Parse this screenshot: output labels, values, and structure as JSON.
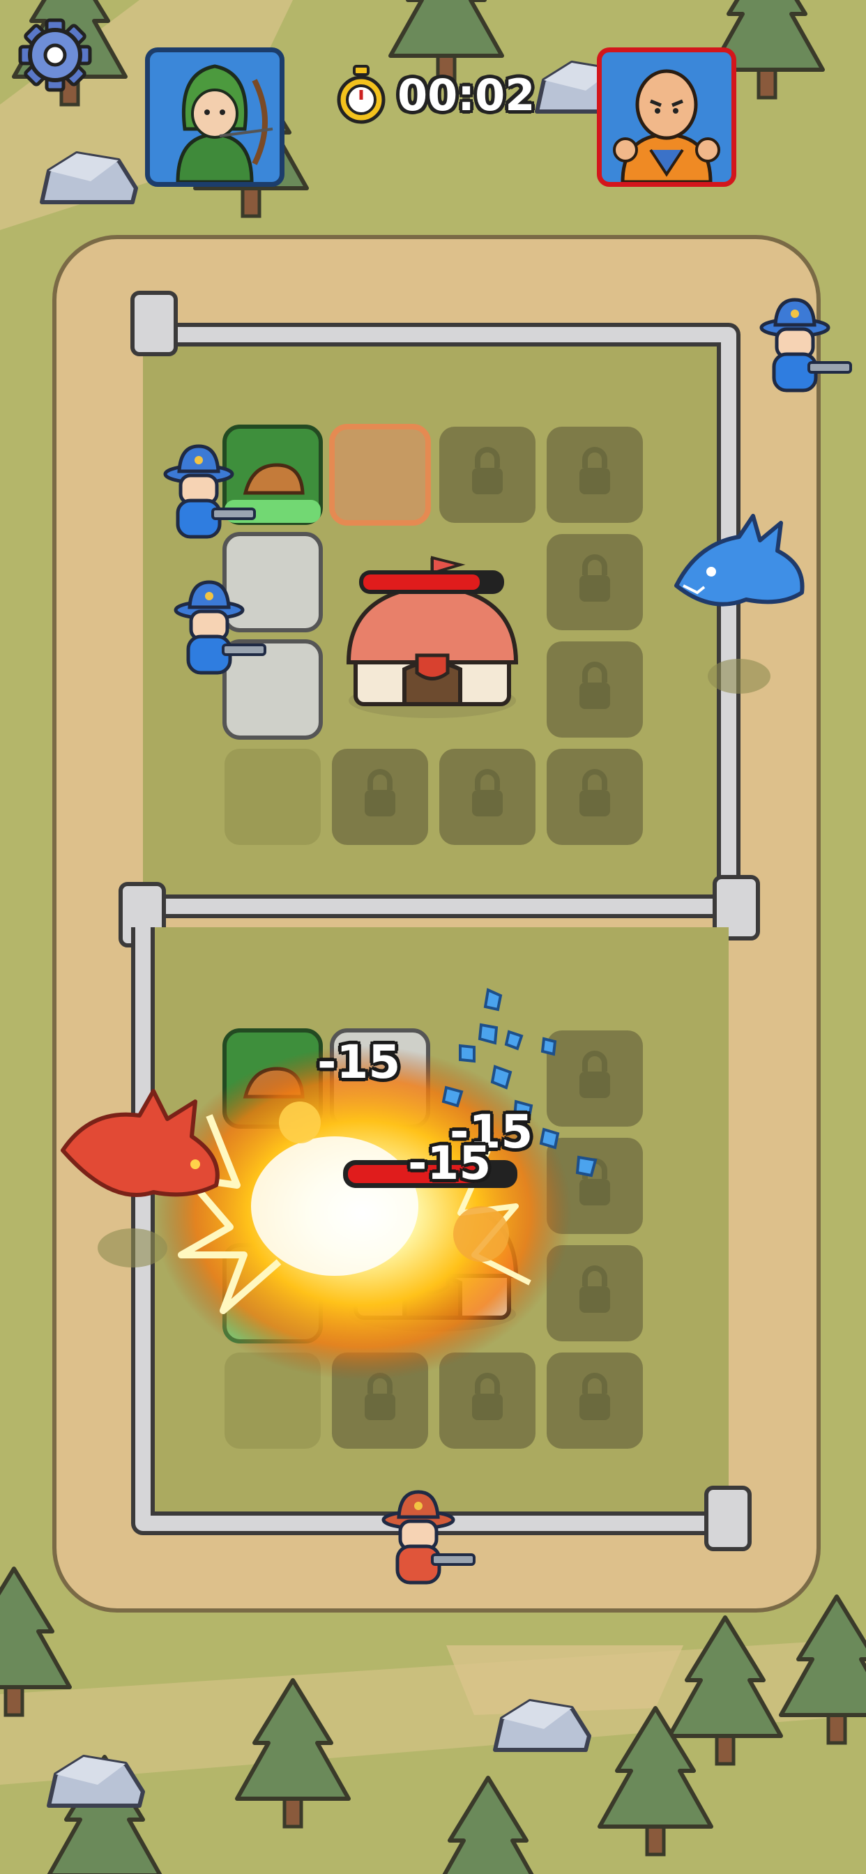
{
  "hud": {
    "settings_icon": "gear-icon",
    "player_portrait": "archer-hero-portrait",
    "opponent_portrait": "monk-hero-portrait",
    "timer_icon": "stopwatch-icon",
    "timer_text": "00:02"
  },
  "board_top": {
    "owner": "player",
    "base_health_fraction": 0.85,
    "tiles": [
      {
        "row": 0,
        "col": 0,
        "state": "placed-unit",
        "unit": "sandbag-barricade"
      },
      {
        "row": 0,
        "col": 1,
        "state": "selected-empty"
      },
      {
        "row": 0,
        "col": 2,
        "state": "locked"
      },
      {
        "row": 0,
        "col": 3,
        "state": "locked"
      },
      {
        "row": 1,
        "col": 0,
        "state": "placed-unit",
        "unit": "gunner"
      },
      {
        "row": 1,
        "col": 3,
        "state": "locked"
      },
      {
        "row": 2,
        "col": 0,
        "state": "placed-unit",
        "unit": "ice-dragon"
      },
      {
        "row": 2,
        "col": 3,
        "state": "locked"
      },
      {
        "row": 3,
        "col": 0,
        "state": "empty"
      },
      {
        "row": 3,
        "col": 1,
        "state": "locked"
      },
      {
        "row": 3,
        "col": 2,
        "state": "locked"
      },
      {
        "row": 3,
        "col": 3,
        "state": "locked"
      }
    ]
  },
  "board_bottom": {
    "owner": "opponent",
    "base_health_fraction": 0.82,
    "tiles": [
      {
        "row": 0,
        "col": 0,
        "state": "placed-unit",
        "unit": "sandbag-barricade"
      },
      {
        "row": 0,
        "col": 1,
        "state": "placed-unit"
      },
      {
        "row": 0,
        "col": 3,
        "state": "locked"
      },
      {
        "row": 1,
        "col": 3,
        "state": "locked"
      },
      {
        "row": 2,
        "col": 0,
        "state": "placed-unit",
        "unit": "gunner"
      },
      {
        "row": 2,
        "col": 3,
        "state": "locked"
      },
      {
        "row": 3,
        "col": 0,
        "state": "empty"
      },
      {
        "row": 3,
        "col": 1,
        "state": "locked"
      },
      {
        "row": 3,
        "col": 2,
        "state": "locked"
      },
      {
        "row": 3,
        "col": 3,
        "state": "locked"
      }
    ]
  },
  "damage_numbers": [
    "-15",
    "-15",
    "-15"
  ],
  "units": {
    "blue_gunners": 3,
    "ice_dragon": "ice-dragon",
    "fire_dragon": "fire-dragon",
    "red_gunner": "red-gunner"
  },
  "colors": {
    "grass": "#b4b66a",
    "path": "#ddc08b",
    "board_field": "#abaa60",
    "locked_tile": "#7e7b48",
    "health_red": "#e01c1c",
    "player_frame": "#1c3d6b",
    "opponent_frame": "#d3161c"
  }
}
